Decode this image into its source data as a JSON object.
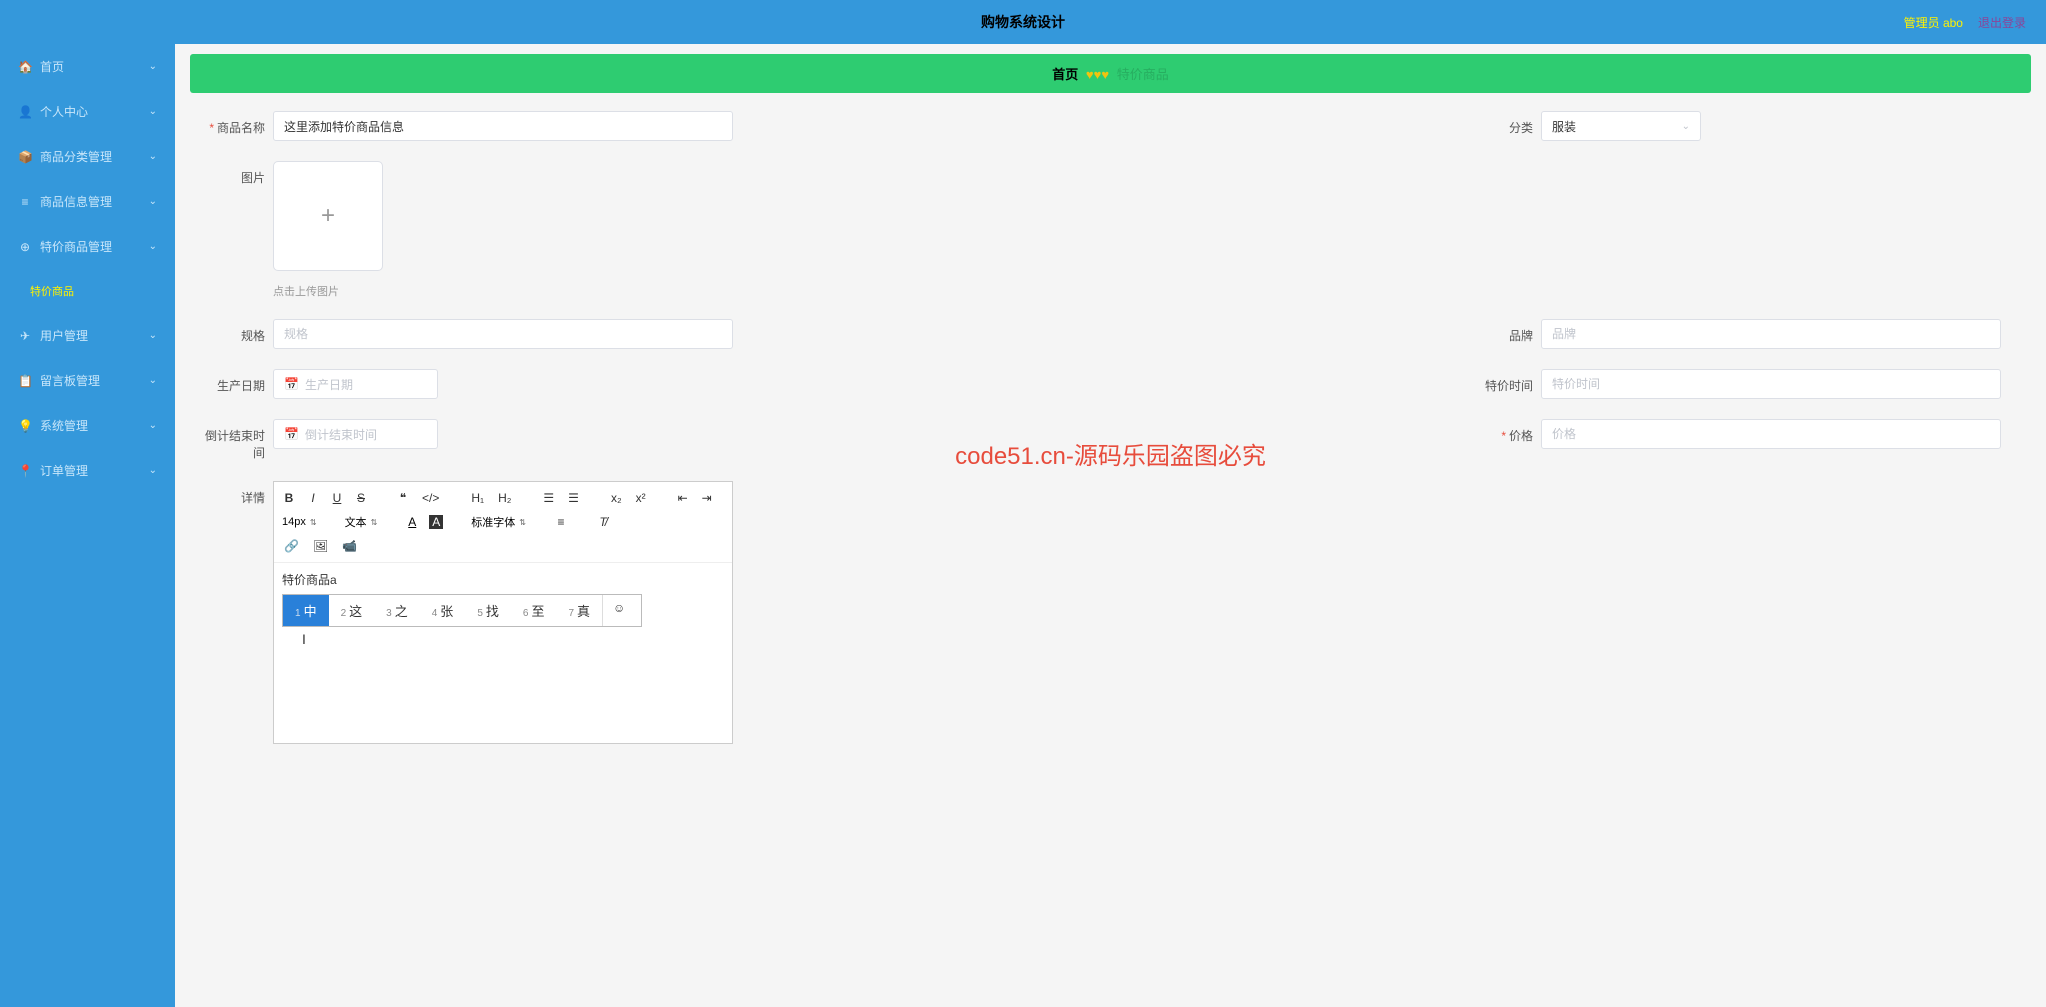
{
  "header": {
    "title": "购物系统设计",
    "admin_label": "管理员 abo",
    "logout": "退出登录"
  },
  "sidebar": {
    "items": [
      {
        "icon": "🏠",
        "label": "首页",
        "expandable": true
      },
      {
        "icon": "👤",
        "label": "个人中心",
        "expandable": true
      },
      {
        "icon": "📦",
        "label": "商品分类管理",
        "expandable": true
      },
      {
        "icon": "≡",
        "label": "商品信息管理",
        "expandable": true
      },
      {
        "icon": "⊕",
        "label": "特价商品管理",
        "expandable": true
      },
      {
        "icon": "",
        "label": "特价商品",
        "active": true
      },
      {
        "icon": "✈",
        "label": "用户管理",
        "expandable": true
      },
      {
        "icon": "📋",
        "label": "留言板管理",
        "expandable": true
      },
      {
        "icon": "💡",
        "label": "系统管理",
        "expandable": true
      },
      {
        "icon": "📍",
        "label": "订单管理",
        "expandable": true
      }
    ]
  },
  "breadcrumb": {
    "home": "首页",
    "hearts": "♥♥♥",
    "page": "特价商品"
  },
  "form": {
    "product_name": {
      "label": "商品名称",
      "value": "这里添加特价商品信息",
      "required": true
    },
    "category": {
      "label": "分类",
      "value": "服装"
    },
    "image": {
      "label": "图片",
      "hint": "点击上传图片"
    },
    "spec": {
      "label": "规格",
      "placeholder": "规格"
    },
    "brand": {
      "label": "品牌",
      "placeholder": "品牌"
    },
    "production_date": {
      "label": "生产日期",
      "placeholder": "生产日期"
    },
    "special_time": {
      "label": "特价时间",
      "placeholder": "特价时间"
    },
    "countdown": {
      "label": "倒计结束时间",
      "placeholder": "倒计结束时间"
    },
    "price": {
      "label": "价格",
      "placeholder": "价格",
      "required": true
    },
    "detail": {
      "label": "详情"
    }
  },
  "editor": {
    "font_size": "14px",
    "format": "文本",
    "font_family": "标准字体",
    "content": "特价商品a",
    "ime_candidates": [
      {
        "num": "1",
        "char": "中",
        "selected": true
      },
      {
        "num": "2",
        "char": "这"
      },
      {
        "num": "3",
        "char": "之"
      },
      {
        "num": "4",
        "char": "张"
      },
      {
        "num": "5",
        "char": "找"
      },
      {
        "num": "6",
        "char": "至"
      },
      {
        "num": "7",
        "char": "真"
      }
    ]
  },
  "watermarks": {
    "text": "code51.cn",
    "red_text": "code51.cn-源码乐园盗图必究"
  }
}
